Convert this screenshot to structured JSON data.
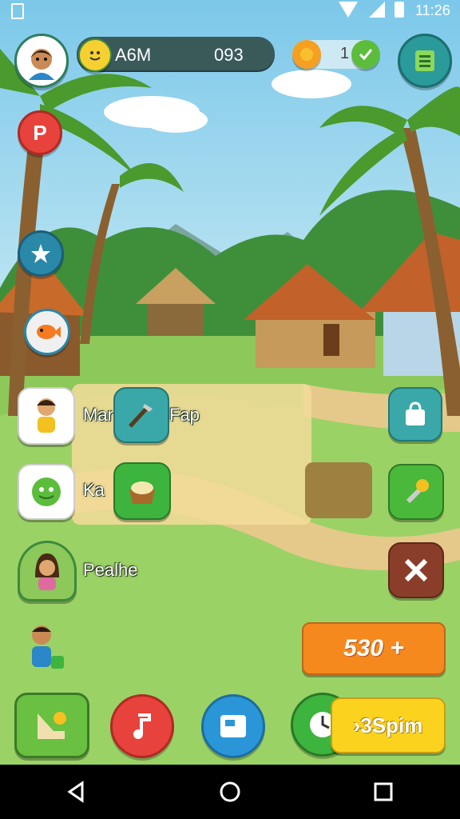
{
  "status_bar": {
    "time": "11:26"
  },
  "top_bar": {
    "player_name": "A6M",
    "score": "093",
    "coins": "1"
  },
  "characters": [
    {
      "label": "Mar"
    },
    {
      "label": "Ka"
    },
    {
      "label": "Pealhe"
    }
  ],
  "actions": [
    {
      "label": "Fap"
    }
  ],
  "price_button": {
    "label": "530 +"
  },
  "spin_button": {
    "label": "›3Spim"
  },
  "colors": {
    "sky": "#87cde8",
    "grass": "#8cc85a",
    "teal_button": "#3aa8a8",
    "green_button": "#3db43d",
    "orange_button": "#f5891e",
    "yellow_button": "#fbd21e",
    "red_button": "#e8423c",
    "blue_button": "#2a96d8"
  }
}
